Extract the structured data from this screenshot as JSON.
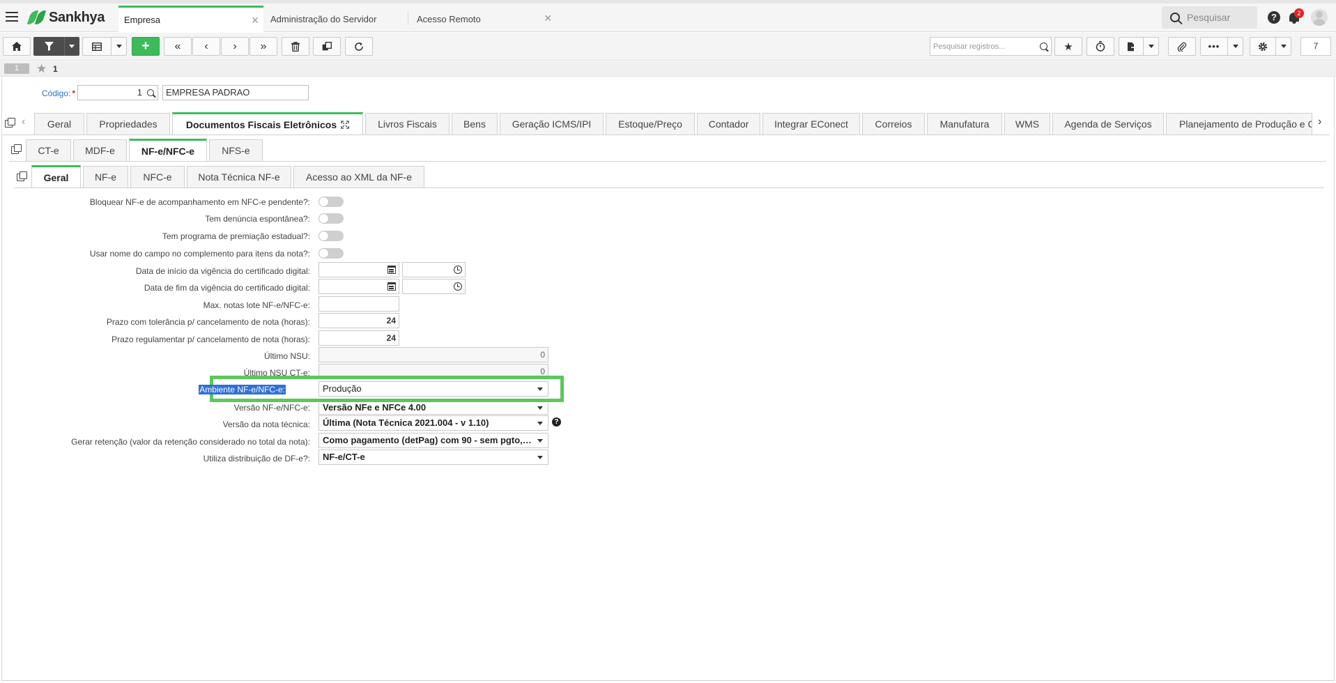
{
  "topbar": {
    "brand": "Sankhya",
    "tabs": [
      {
        "label": "Empresa",
        "active": true
      },
      {
        "label": "Administração do Servidor",
        "active": false
      },
      {
        "label": "Acesso Remoto",
        "active": false
      }
    ],
    "search_placeholder": "Pesquisar",
    "notification_count": "2"
  },
  "toolbar": {
    "search_placeholder": "Pesquisar registros...",
    "count": "7",
    "icons": [
      "home-icon",
      "filter-icon",
      "grid-icon",
      "add-icon",
      "first-icon",
      "previous-icon",
      "next-icon",
      "last-icon",
      "trash-icon",
      "duplicate-icon",
      "refresh-icon",
      "star-icon",
      "timer-icon",
      "export-icon",
      "attach-icon",
      "more-icon",
      "gear-icon"
    ]
  },
  "record": {
    "index": "1",
    "id": "1"
  },
  "header_form": {
    "codigo_label": "Código:",
    "required_mark": "*",
    "codigo_value": "1",
    "empresa_name": "EMPRESA PADRAO"
  },
  "main_tabs": [
    "Geral",
    "Propriedades",
    "Documentos Fiscais Eletrônicos",
    "Livros Fiscais",
    "Bens",
    "Geração ICMS/IPI",
    "Estoque/Preço",
    "Contador",
    "Integrar EConect",
    "Correios",
    "Manufatura",
    "WMS",
    "Agenda de Serviços",
    "Planejamento de Produção e C"
  ],
  "sub_tabs": [
    "CT-e",
    "MDF-e",
    "NF-e/NFC-e",
    "NFS-e"
  ],
  "inner_tabs": [
    "Geral",
    "NF-e",
    "NFC-e",
    "Nota Técnica NF-e",
    "Acesso ao XML da NF-e"
  ],
  "form": {
    "bloquear_label": "Bloquear NF-e de acompanhamento em NFC-e pendente?:",
    "denuncia_label": "Tem denúncia espontânea?:",
    "premiacao_label": "Tem programa de premiação estadual?:",
    "usar_nome_label": "Usar nome do campo no complemento para itens da nota?:",
    "inicio_vigencia_label": "Data de início da vigência do certificado digital:",
    "fim_vigencia_label": "Data de fim da vigência do certificado digital:",
    "max_notas_label": "Max. notas lote NF-e/NFC-e:",
    "prazo_tolerancia_label": "Prazo com tolerância p/ cancelamento de nota (horas):",
    "prazo_tolerancia_value": "24",
    "prazo_regulamentar_label": "Prazo regulamentar p/ cancelamento de nota (horas):",
    "prazo_regulamentar_value": "24",
    "ultimo_nsu_label": "Último NSU:",
    "ultimo_nsu_value": "0",
    "ultimo_nsu_cte_label": "Último NSU CT-e:",
    "ultimo_nsu_cte_value": "0",
    "ambiente_label": "Ambiente NF-e/NFC-e:",
    "ambiente_value": "Produção",
    "versao_label": "Versão NF-e/NFC-e:",
    "versao_value": "Versão NFe e NFCe 4.00",
    "versao_nota_label": "Versão da nota técnica:",
    "versao_nota_value": "Última (Nota Técnica 2021.004 - v 1.10)",
    "retencao_label": "Gerar retenção (valor da retenção considerado no total da nota):",
    "retencao_value": "Como pagamento (detPag) com 90 - sem pgto, ...",
    "distribuicao_label": "Utiliza distribuição de DF-e?:",
    "distribuicao_value": "NF-e/CT-e"
  },
  "colors": {
    "accent": "#3dbb5b",
    "highlight_box": "#5ac85a",
    "link_label": "#2573c9",
    "selection": "#2f6fd6"
  }
}
